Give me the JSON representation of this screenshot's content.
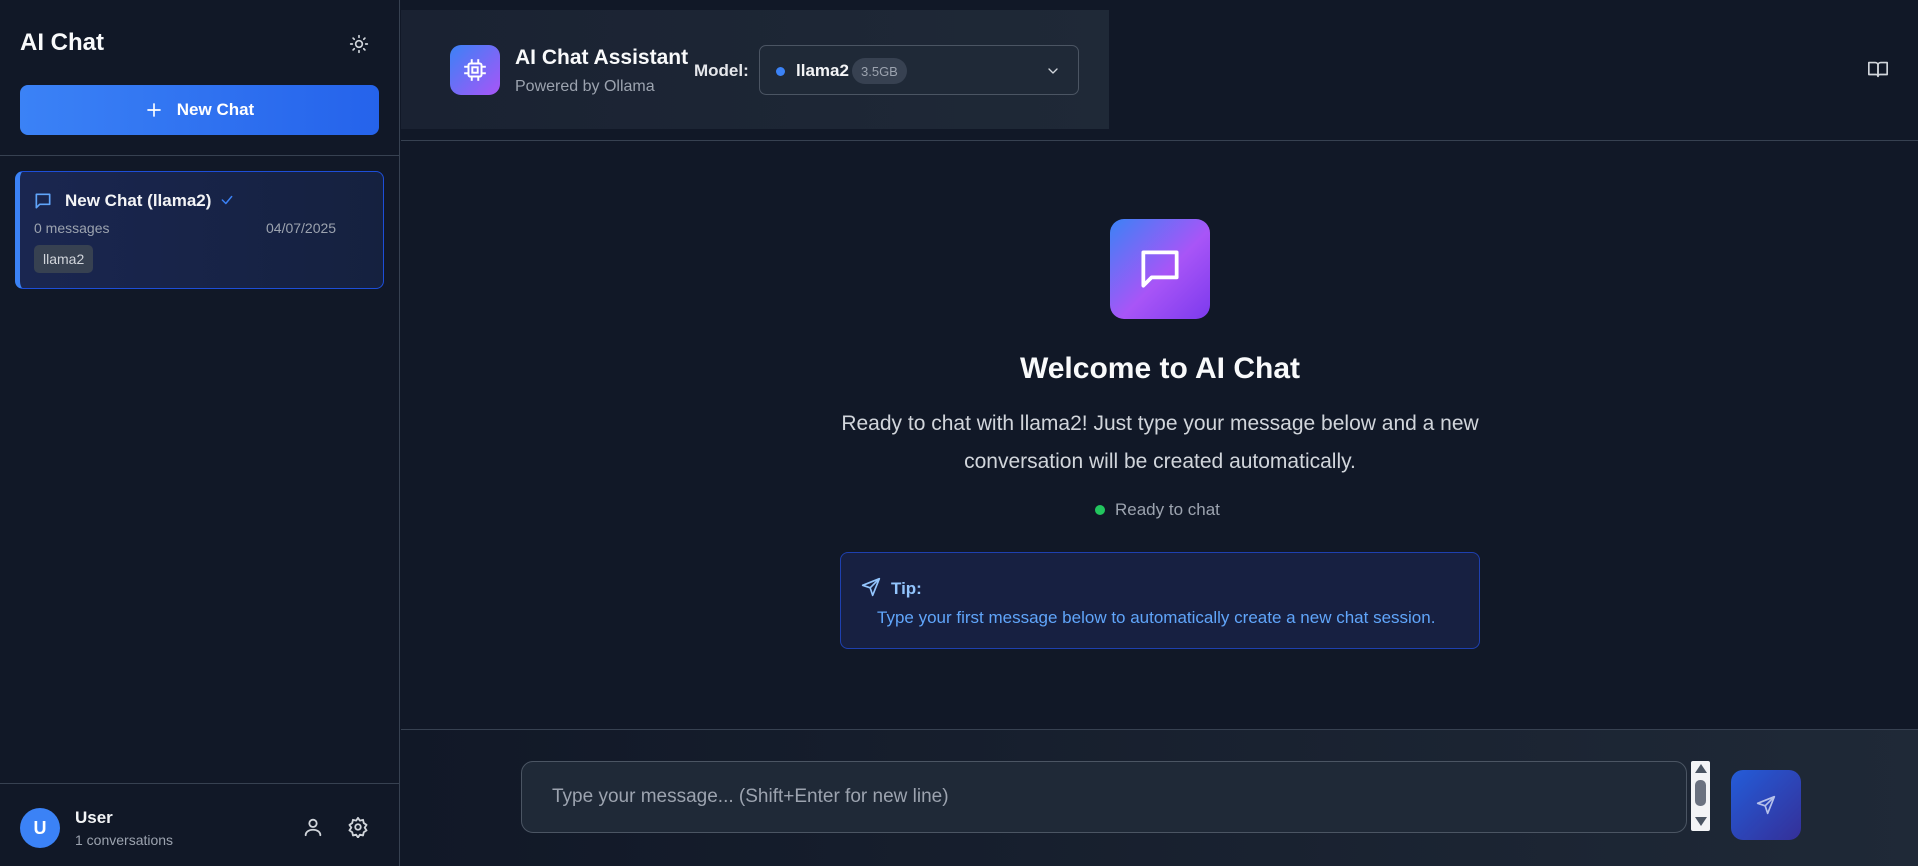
{
  "sidebar": {
    "title": "AI Chat",
    "theme_icon": "sun-icon",
    "new_chat_label": "New Chat",
    "chats": [
      {
        "title": "New Chat (llama2)",
        "messages": "0 messages",
        "date": "04/07/2025",
        "model_badge": "llama2",
        "active": true
      }
    ],
    "user": {
      "initial": "U",
      "name": "User",
      "conversations": "1 conversations"
    }
  },
  "header": {
    "title": "AI Chat Assistant",
    "subtitle": "Powered by Ollama",
    "model_label": "Model:",
    "model_name": "llama2",
    "model_size": "3.5GB"
  },
  "welcome": {
    "title": "Welcome to AI Chat",
    "description": "Ready to chat with llama2! Just type your message below and a new conversation will be created automatically.",
    "status": "Ready to chat",
    "tip_label": "Tip:",
    "tip_text": "Type your first message below to automatically create a new chat session."
  },
  "composer": {
    "placeholder": "Type your message... (Shift+Enter for new line)"
  },
  "colors": {
    "accent": "#3b82f6",
    "purple": "#a855f7",
    "status_green": "#22c55e",
    "background": "#111827"
  }
}
